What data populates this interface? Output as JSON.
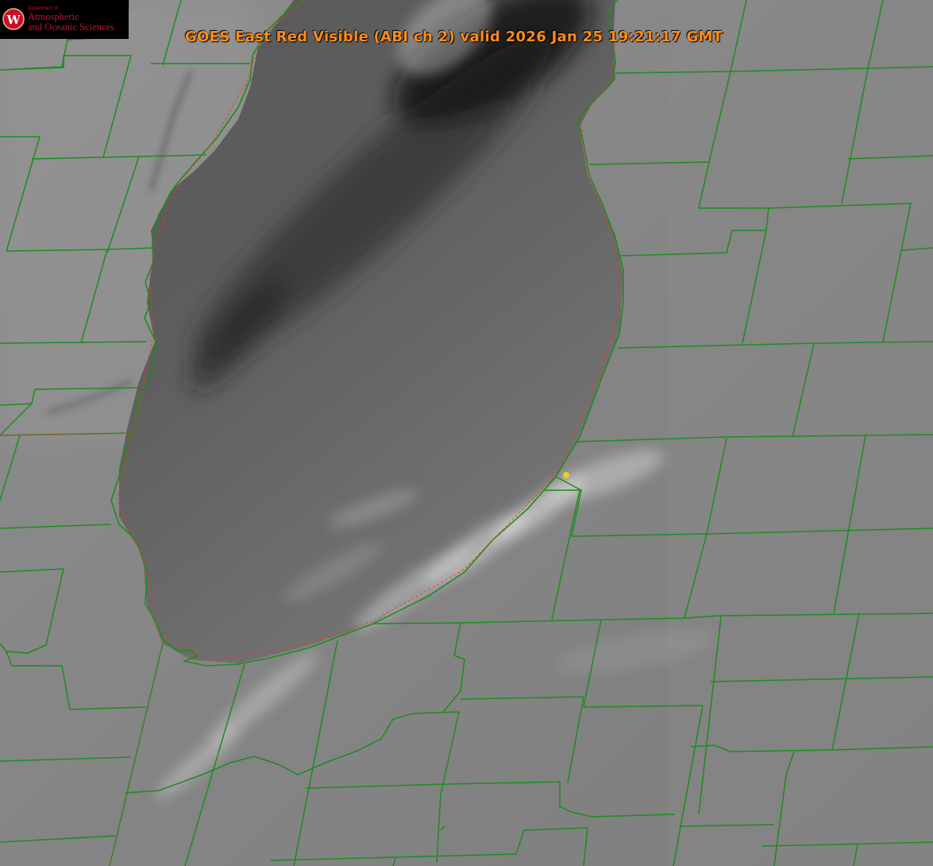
{
  "header": {
    "title": "GOES East Red Visible (ABI ch 2) valid 2026 Jan 25 19:21:17 GMT"
  },
  "logo": {
    "dept_label": "Department of",
    "line1": "Atmospheric",
    "line2": "and Oceanic Sciences",
    "seal_letter": "W",
    "color": "#c8102e"
  },
  "colors": {
    "county_lines": "#1e8c1e",
    "shoreline": "#ff3030",
    "title_text": "#ff8c1a",
    "marker": "#e6d21a"
  }
}
